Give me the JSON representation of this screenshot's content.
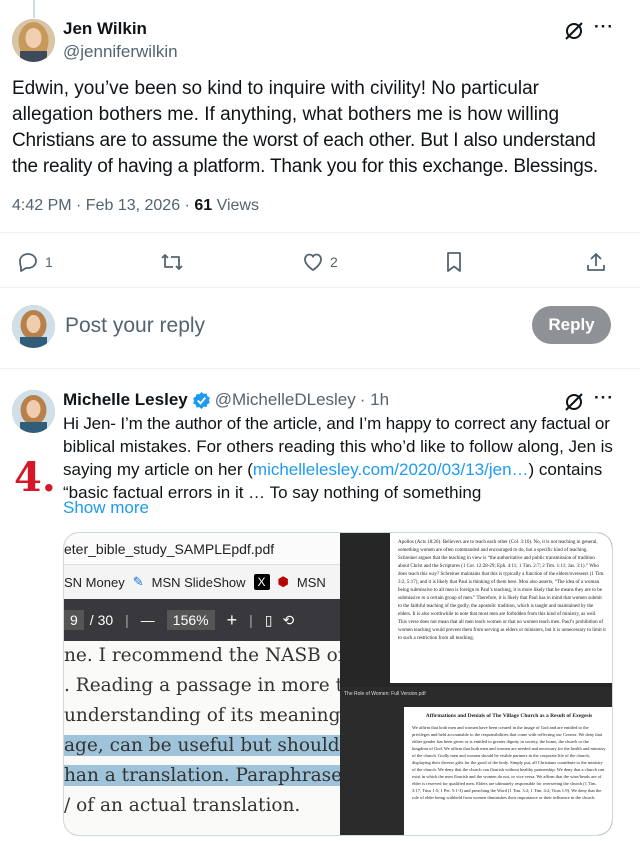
{
  "main_tweet": {
    "author_name": "Jen Wilkin",
    "author_handle": "@jenniferwilkin",
    "text": "Edwin, you’ve been so kind to inquire with civility! No particular allegation bothers me. If anything, what bothers me is how willing Christians are to assume the worst of each other. But I also understand the reality of having a platform. Thank you for this exchange. Blessings.",
    "line1": "Edwin, you’ve been so kind to inquire with civility! No particular",
    "line2": "allegation bothers me. If anything, what bothers me is how willing",
    "line3": "Christians are to assume the worst of each other. But I also understand",
    "line4": "the reality of having a platform. Thank you for this exchange. Blessings.",
    "time": "4:42 PM · Feb 13, 2026 · ",
    "views_count": "61",
    "views_label": " Views",
    "reply_count": "1",
    "like_count": "2",
    "more": "···"
  },
  "reply_box": {
    "placeholder": "Post your reply",
    "button": "Reply"
  },
  "reply_tweet": {
    "author_name": "Michelle Lesley",
    "author_handle": "@MichelleDLesley",
    "age": " · 1h",
    "line1": "Hi Jen- I’m the author of the article, and I’m happy to correct any factual or",
    "line2": "biblical mistakes. For others reading this who’d like to follow along, Jen is",
    "line3_a": "saying my article on her (",
    "line3_link": "michellelesley.com/2020/03/13/jen…",
    "line3_b": ") contains",
    "line4": "“basic factual errors in it … To say nothing of something",
    "show_more": "Show more",
    "more": "···",
    "annotation": "4."
  },
  "media": {
    "pdf_title": "eter_bible_study_SAMPLEpdf.pdf",
    "bookmarks": [
      "SN Money",
      "MSN SlideShow",
      "MSN"
    ],
    "page_indicator": "9",
    "page_total": "/ 30",
    "zoom": "156%",
    "minus": "—",
    "plus": "+",
    "pdf_lines": [
      "ne. I recommend the NASB or .",
      ". Reading a passage in more th",
      "understanding of its meaning.",
      "age, can be useful but should b",
      "han a translation. Paraphrases",
      "/ of an actual translation."
    ],
    "page1_text": "Apollos (Acts 18:26). Believers are to teach each other (Col. 3:16). No, it is not teaching in general, something women are often commanded and encouraged to do, but a specific kind of teaching. Schreiner argues that the teaching in view is “the authoritative and public transmission of tradition about Christ and the Scriptures (1 Cor. 12:28-29; Eph. 4:11; 1 Tim. 2:7; 2 Tim. 1:11; Jas. 3:1).” Who does teach this way? Schreiner maintains that this is typically a function of the elders/overseers (1 Tim. 3:2, 5:17), and it is likely that Paul is thinking of them here. Moo also asserts, “The idea of a woman being submissive to all men is foreign to Paul’s teaching, it is more likely that he means they are to be submissive to a certain group of men.” Therefore, it is likely that Paul has in mind that women submit to the faithful teaching of the godly, the apostolic tradition, which is taught and maintained by the elders. It is also worthwhile to note that most men are forbidden from this kind of ministry, as well. This verse does not mean that all men teach women or that no women teach men. Paul’s prohibition of women teaching would prevent them from serving as elders or ministers, but it is unnecessary to limit it to such a restriction from all teaching.",
    "page2_heading": "Affirmations and Denials of The Village Church as a Result of Exegesis",
    "page2_tab": "The Role of Women: Full Version.pdf",
    "page2_text": "We affirm that both men and women have been created in the image of God and are entitled to the privileges and held accountable to the responsibilities that come with reflecting our Creator. We deny that either gender has been given or is entitled to greater dignity in society, the home, the church or the kingdom of God. We affirm that both men and women are needed and necessary for the health and ministry of the church. Godly men and women should be visible partners in the corporate life of the church, displaying their diverse gifts for the good of the body. Simply put, all Christians contribute to the ministry of the church. We deny that the church can flourish without healthy partnership. We deny that a church can exist in which the men flourish and the women do not, or vice versa. We affirm that the wise/heads are of elder is reserved for qualified men. Elders are ultimately responsible for overseeing the church (1 Tim. 3:17, Titus 1:5; 1 Pet. 5:1-3) and preaching the Word (1 Tim. 3:2; 1 Tim. 4:2; Titus 1:9). We deny that the role of elder being withheld from women diminishes their importance or their influence in the church."
  },
  "colors": {
    "text": "#0f1419",
    "secondary": "#536471",
    "link": "#1d9bf0",
    "verified": "#1d9bf0",
    "annotation_red": "#d4182a",
    "reply_button": "#8e9196"
  }
}
